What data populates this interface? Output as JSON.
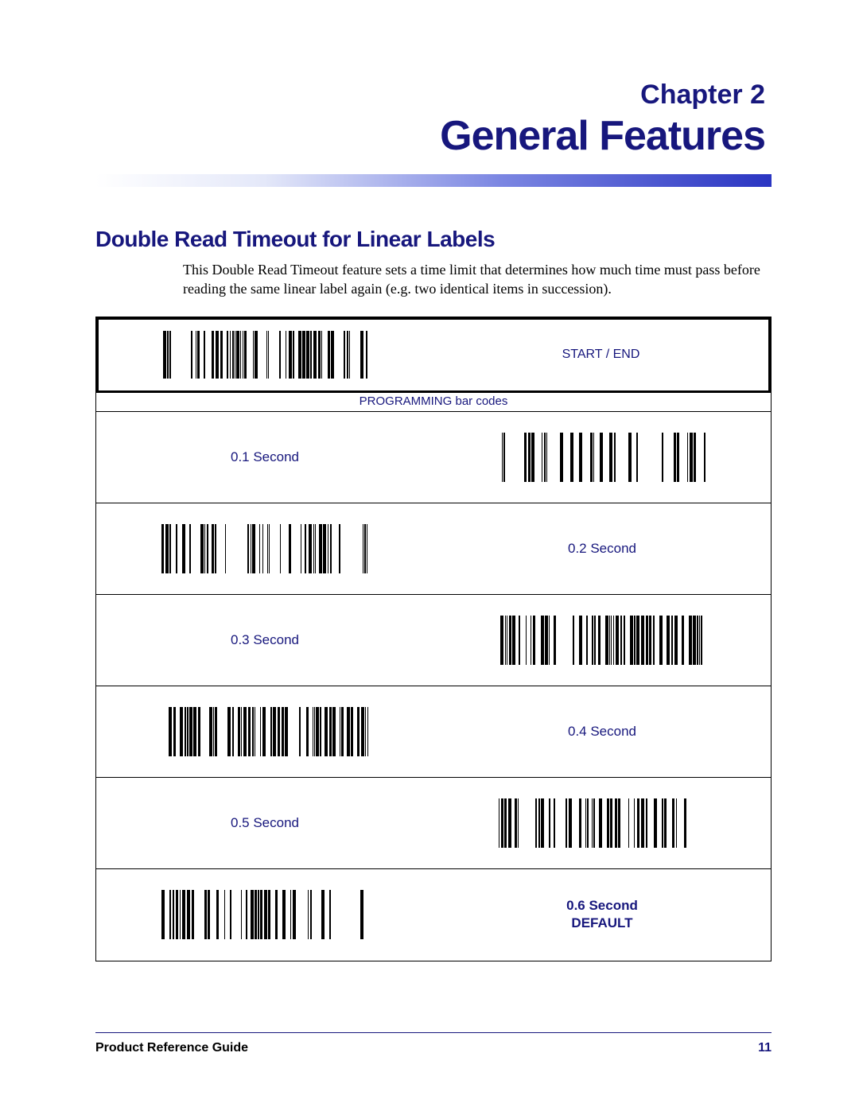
{
  "chapter": {
    "number": "Chapter 2",
    "title": "General Features"
  },
  "section": {
    "heading": "Double Read Timeout for Linear Labels",
    "body": "This Double Read Timeout feature sets a time limit that determines how much time must pass before reading the same linear label again (e.g. two identical items in succession)."
  },
  "table": {
    "start_end": "START / END",
    "prog_caption": "PROGRAMMING bar codes",
    "rows": [
      {
        "left_label": "0.1 Second",
        "right_barcode": true,
        "left_barcode": false,
        "bold": false
      },
      {
        "left_barcode": true,
        "right_label": "0.2 Second",
        "right_barcode": false,
        "bold": false
      },
      {
        "left_label": "0.3 Second",
        "right_barcode": true,
        "left_barcode": false,
        "bold": false
      },
      {
        "left_barcode": true,
        "right_label": "0.4 Second",
        "right_barcode": false,
        "bold": false
      },
      {
        "left_label": "0.5 Second",
        "right_barcode": true,
        "left_barcode": false,
        "bold": false
      },
      {
        "left_barcode": true,
        "right_label": "0.6 Second\nDEFAULT",
        "right_barcode": false,
        "bold": true
      }
    ]
  },
  "footer": {
    "left": "Product Reference Guide",
    "right": "11"
  }
}
